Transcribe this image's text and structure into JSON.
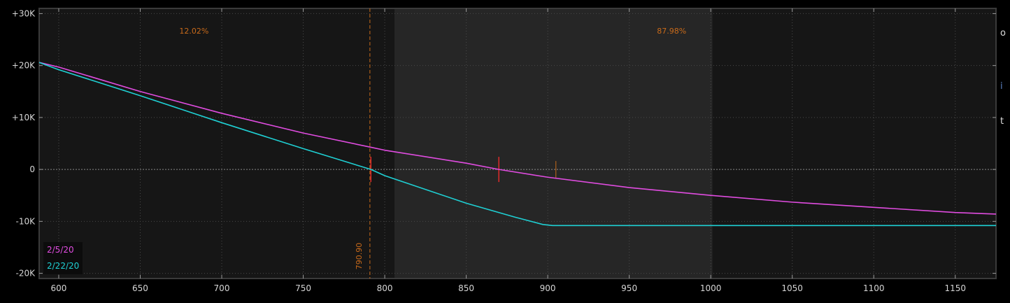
{
  "chart_data": {
    "type": "line",
    "xlim": [
      588,
      1175
    ],
    "ylim": [
      -21000,
      31000
    ],
    "x_ticks": [
      {
        "value": 600,
        "label": "600"
      },
      {
        "value": 650,
        "label": "650"
      },
      {
        "value": 700,
        "label": "700"
      },
      {
        "value": 750,
        "label": "750"
      },
      {
        "value": 800,
        "label": "800"
      },
      {
        "value": 850,
        "label": "850"
      },
      {
        "value": 900,
        "label": "900"
      },
      {
        "value": 950,
        "label": "950"
      },
      {
        "value": 1000,
        "label": "1000"
      },
      {
        "value": 1050,
        "label": "1050"
      },
      {
        "value": 1100,
        "label": "1100"
      },
      {
        "value": 1150,
        "label": "1150"
      }
    ],
    "y_ticks": [
      {
        "value": 30000,
        "label": "+30K"
      },
      {
        "value": 20000,
        "label": "+20K"
      },
      {
        "value": 10000,
        "label": "+10K"
      },
      {
        "value": 0,
        "label": "0"
      },
      {
        "value": -10000,
        "label": "-10K"
      },
      {
        "value": -20000,
        "label": "-20K"
      }
    ],
    "grid": true,
    "probability_band": {
      "x_start": 806,
      "x_end": 1001
    },
    "probability_labels": [
      {
        "text": "12.02%",
        "x": 683
      },
      {
        "text": "87.98%",
        "x": 976
      }
    ],
    "current_price": {
      "value": 790.9,
      "label": "790.90"
    },
    "breakeven_markers": [
      791.5,
      870
    ],
    "price_marker": 905,
    "series": [
      {
        "name": "2/5/20",
        "color": "#e04ce0",
        "x": [
          588,
          600,
          650,
          700,
          750,
          791,
          800,
          850,
          870,
          900,
          950,
          1000,
          1050,
          1100,
          1150,
          1175
        ],
        "y": [
          20600,
          19700,
          15000,
          10800,
          7000,
          4300,
          3700,
          1200,
          0,
          -1500,
          -3500,
          -5000,
          -6300,
          -7300,
          -8300,
          -8600
        ]
      },
      {
        "name": "2/22/20",
        "color": "#1fd0d4",
        "x": [
          588,
          600,
          650,
          700,
          750,
          791.5,
          800,
          850,
          880,
          897,
          903,
          950,
          1000,
          1050,
          1100,
          1150,
          1175
        ],
        "y": [
          20600,
          19200,
          14200,
          9000,
          4000,
          0,
          -1200,
          -6500,
          -9200,
          -10600,
          -10800,
          -10800,
          -10800,
          -10800,
          -10800,
          -10800,
          -10800
        ]
      }
    ]
  },
  "edge_glyphs": [
    "o",
    "i",
    "t"
  ]
}
